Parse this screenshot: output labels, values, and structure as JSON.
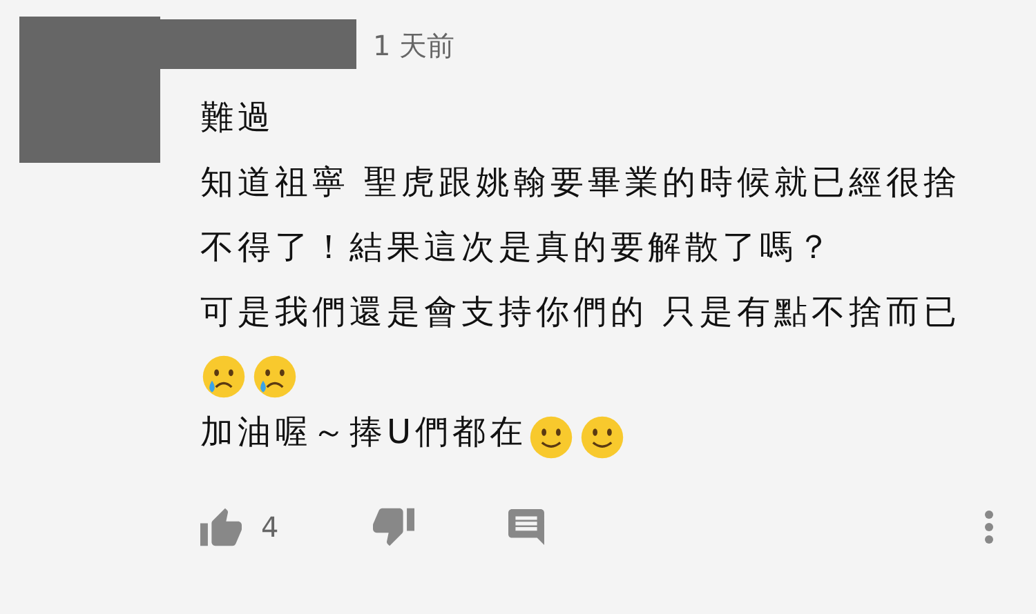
{
  "comment": {
    "time": "1 天前",
    "paragraphs": [
      {
        "text": "難過"
      },
      {
        "text": "知道祖寧 聖虎跟姚翰要畢業的時候就已經很捨不得了！結果這次是真的要解散了嗎？"
      },
      {
        "text": "可是我們還是會支持你們的 只是有點不捨而已"
      },
      {
        "emojis": [
          {
            "kind": "crying"
          },
          {
            "kind": "crying"
          }
        ]
      },
      {
        "text": "加油喔～捧U們都在",
        "emojis": [
          {
            "kind": "smiling"
          },
          {
            "kind": "smiling"
          }
        ]
      }
    ],
    "like_count": "4"
  }
}
